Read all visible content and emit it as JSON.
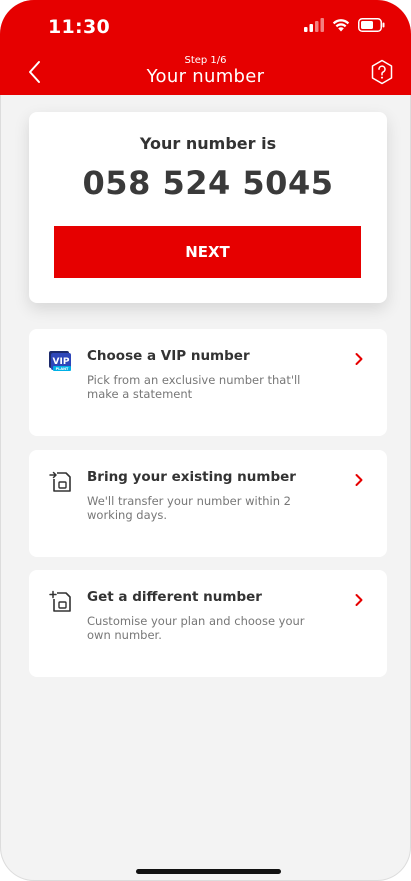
{
  "status_bar": {
    "time": "11:30"
  },
  "header": {
    "step": "Step 1/6",
    "title": "Your number"
  },
  "number_card": {
    "label": "Your number is",
    "number": "058 524 5045",
    "next_label": "NEXT"
  },
  "options": [
    {
      "title": "Choose a VIP number",
      "desc": "Pick from an exclusive number that'll make a statement",
      "icon": "vip-icon"
    },
    {
      "title": "Bring your existing number",
      "desc": "We'll transfer your number within 2 working days.",
      "icon": "sim-transfer-icon"
    },
    {
      "title": "Get a different number",
      "desc": "Customise your plan and choose your own number.",
      "icon": "sim-add-icon"
    }
  ],
  "vip_badge": {
    "text": "VIP",
    "subtext": "PLANT"
  },
  "colors": {
    "brand": "#e60000",
    "background": "#f3f3f3",
    "card": "#ffffff",
    "text": "#333333"
  }
}
